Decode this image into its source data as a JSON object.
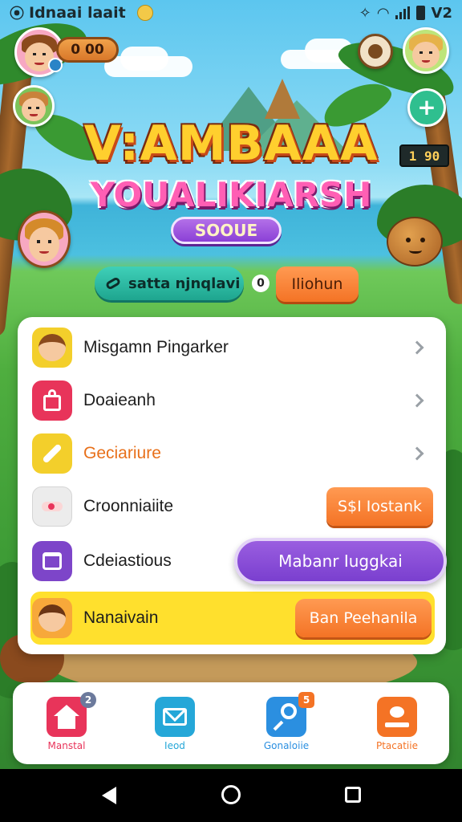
{
  "status_bar": {
    "left_text": "Idnaai laait",
    "right_text": "V2"
  },
  "header": {
    "coins": "0 00",
    "score": "1 90"
  },
  "title": {
    "line1": "V:AMBAAA",
    "line2": "YOUALIKIARSH",
    "badge": "SOOUE"
  },
  "actions": {
    "primary_label": "satta njnqlavi",
    "info_marker": "0",
    "secondary_label": "Iliohun"
  },
  "menu": {
    "items": [
      {
        "label": "Misgamn Pingarker",
        "icon": "avatar-icon",
        "color": "#f3cf2b",
        "trailing": "chevron"
      },
      {
        "label": "Doaieanh",
        "icon": "bag-icon",
        "color": "#e8345a",
        "trailing": "chevron"
      },
      {
        "label": "Geciariure",
        "icon": "wrench-icon",
        "color": "#f3cf2b",
        "trailing": "chevron",
        "label_color": "#e8701a"
      },
      {
        "label": "Croonniaiite",
        "icon": "toggle-icon",
        "color": "#e6e6e6",
        "trailing": "button",
        "button_label": "S$I Iostank"
      },
      {
        "label": "Cdeiastious",
        "icon": "gift-icon",
        "color": "#7d45c9",
        "trailing": "button",
        "button_label": "Mabanr Iuggkai"
      },
      {
        "label": "Nanaivain",
        "icon": "avatar-icon",
        "color": "#f3cf2b",
        "trailing": "button",
        "button_label": "Ban Peehanila"
      }
    ]
  },
  "bottom_nav": {
    "items": [
      {
        "label": "Manstal",
        "icon": "home-icon",
        "color": "#e8345a",
        "label_color": "#e8345a",
        "badge": "2"
      },
      {
        "label": "Ieod",
        "icon": "mail-icon",
        "color": "#25a7d8",
        "label_color": "#25a7d8"
      },
      {
        "label": "Gonaloiie",
        "icon": "search-icon",
        "color": "#2b8fe0",
        "label_color": "#2b8fe0",
        "badge": "5"
      },
      {
        "label": "Ptacatiie",
        "icon": "profile-icon",
        "color": "#f47325",
        "label_color": "#f47325"
      }
    ]
  },
  "colors": {
    "accent_orange": "#f47325",
    "accent_purple": "#8b40d6",
    "accent_teal": "#1ea58f",
    "highlight_yellow": "#ffe02d"
  }
}
